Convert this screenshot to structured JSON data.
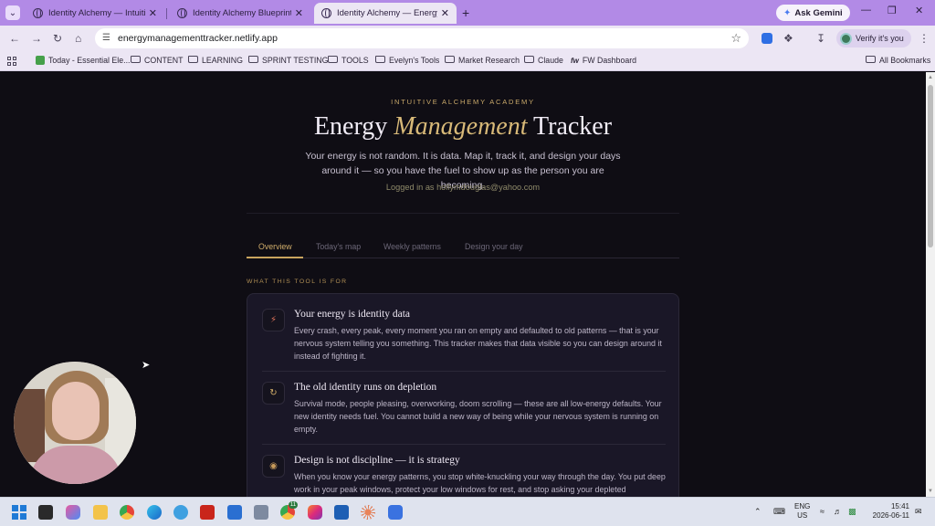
{
  "browser": {
    "tabs": [
      {
        "title": "Identity Alchemy — Intuitive A",
        "active": false
      },
      {
        "title": "Identity Alchemy Blueprint — I",
        "active": false
      },
      {
        "title": "Identity Alchemy — Energy Ma",
        "active": true
      }
    ],
    "new_tab": "+",
    "ask_gemini": "Ask Gemini",
    "url": "energymanagementtracker.netlify.app",
    "verify": "Verify it's you",
    "bookmarks": [
      "Today - Essential Ele...",
      "CONTENT",
      "LEARNING",
      "SPRINT TESTING",
      "TOOLS",
      "Evelyn's Tools",
      "Market Research",
      "Claude",
      "FW Dashboard"
    ],
    "all_bookmarks": "All Bookmarks"
  },
  "page": {
    "eyebrow": "INTUITIVE ALCHEMY ACADEMY",
    "title_a": "Energy ",
    "title_em": "Management",
    "title_b": " Tracker",
    "subtitle": "Your energy is not random. It is data. Map it, track it, and design your days around it — so you have the fuel to show up as the person you are becoming.",
    "logged_in": "Logged in as hollymdouglas@yahoo.com",
    "tabs": [
      "Overview",
      "Today's map",
      "Weekly patterns",
      "Design your day"
    ],
    "section_label": "WHAT THIS TOOL IS FOR",
    "items": [
      {
        "icon": "lightning-icon",
        "heading": "Your energy is identity data",
        "body": "Every crash, every peak, every moment you ran on empty and defaulted to old patterns — that is your nervous system telling you something. This tracker makes that data visible so you can design around it instead of fighting it."
      },
      {
        "icon": "refresh-icon",
        "heading": "The old identity runs on depletion",
        "body": "Survival mode, people pleasing, overworking, doom scrolling — these are all low-energy defaults. Your new identity needs fuel. You cannot build a new way of being while your nervous system is running on empty."
      },
      {
        "icon": "target-icon",
        "heading": "Design is not discipline — it is strategy",
        "body": "When you know your energy patterns, you stop white-knuckling your way through the day. You put deep work in your peak windows, protect your low windows for rest, and stop asking your depleted"
      }
    ]
  },
  "taskbar": {
    "lang_a": "ENG",
    "lang_b": "US",
    "time": "15:41",
    "date": "2026-06-11",
    "badge": "11"
  },
  "colors": {
    "tabstrip": "#b28ae6",
    "page_bg": "#0f0d14",
    "accent_gold": "#d8b978",
    "card_bg": "#1a1727"
  }
}
